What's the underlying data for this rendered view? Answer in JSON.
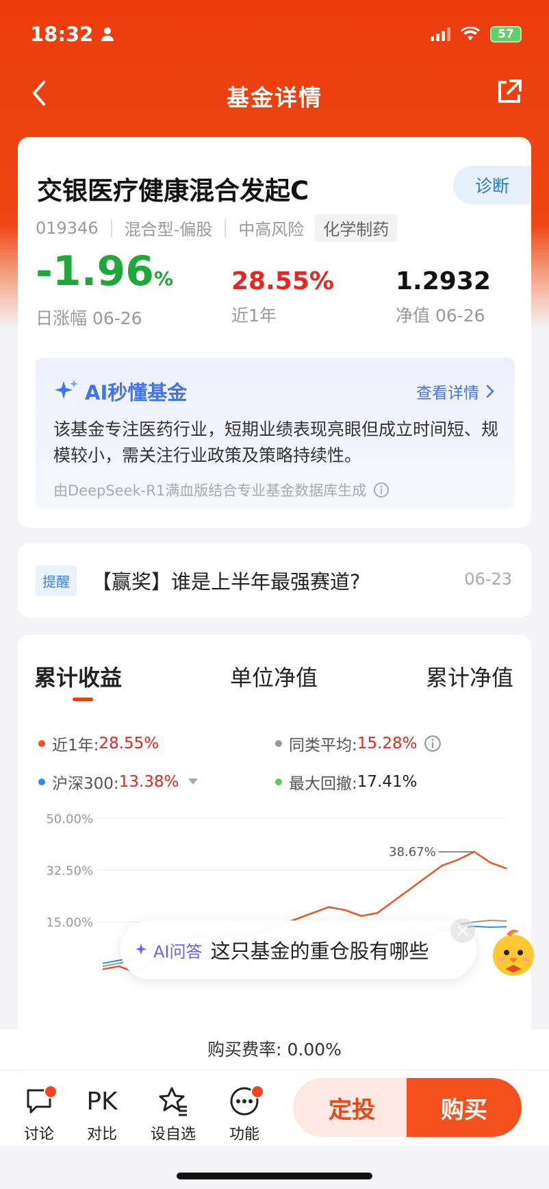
{
  "status": {
    "time": "18:32",
    "battery": "57"
  },
  "nav": {
    "title": "基金详情"
  },
  "fund": {
    "name": "交银医疗健康混合发起C",
    "diagnose_label": "诊断",
    "code": "019346",
    "type": "混合型-偏股",
    "risk": "中高风险",
    "sector": "化学制药",
    "daily_change": "-1.96",
    "daily_change_unit": "%",
    "daily_change_label": "日涨幅 06-26",
    "year_return": "28.55%",
    "year_return_label": "近1年",
    "nav_value": "1.2932",
    "nav_label": "净值 06-26"
  },
  "ai_summary": {
    "title": "AI秒懂基金",
    "detail_link": "查看详情",
    "text": "该基金专注医药行业，短期业绩表现亮眼但成立时间短、规模较小，需关注行业政策及策略持续性。",
    "footer": "由DeepSeek-R1满血版结合专业基金数据库生成"
  },
  "notice": {
    "tag": "提醒",
    "text": "【赢奖】谁是上半年最强赛道?",
    "date": "06-23"
  },
  "chart_tabs": [
    "累计收益",
    "单位净值",
    "累计净值"
  ],
  "legend": {
    "fund_label": "近1年:",
    "fund_value": "28.55%",
    "peer_label": "同类平均:",
    "peer_value": "15.28%",
    "index_label": "沪深300:",
    "index_value": "13.38%",
    "drawdown_label": "最大回撤:",
    "drawdown_value": "17.41%"
  },
  "colors": {
    "fund": "#f4511e",
    "peer": "#999999",
    "index": "#2d8cf0",
    "drawdown": "#5dc860",
    "accent": "#ec3c0d"
  },
  "chart_data": {
    "type": "line",
    "ylim": [
      0,
      50
    ],
    "ytick_labels": [
      "50.00%",
      "32.50%",
      "15.00%"
    ],
    "yticks": [
      50,
      32.5,
      15
    ],
    "peak_annotation": "38.67%",
    "peak_value": 38.67,
    "series": [
      {
        "name": "近1年",
        "values": [
          -1,
          0,
          -2,
          1,
          3,
          2,
          4,
          6,
          8,
          10,
          12,
          14,
          16,
          18,
          20,
          19,
          17,
          18,
          22,
          26,
          30,
          34,
          36,
          38.67,
          35,
          33
        ]
      },
      {
        "name": "同类平均",
        "values": [
          0,
          1,
          2,
          6,
          9,
          10,
          11,
          10,
          12,
          11,
          9,
          10,
          8,
          9,
          7,
          8,
          9,
          10,
          11,
          12,
          11,
          13,
          14,
          15,
          15.5,
          15.28
        ]
      },
      {
        "name": "沪深300",
        "values": [
          1,
          2,
          3,
          6,
          8,
          9,
          10,
          9,
          11,
          10,
          8,
          9,
          7,
          8,
          6,
          7,
          8,
          9,
          10,
          11,
          10,
          12,
          13,
          13.5,
          13.2,
          13.38
        ]
      }
    ]
  },
  "ai_bubble": {
    "label": "AI问答",
    "question": "这只基金的重仓股有哪些"
  },
  "fee": {
    "text": "购买费率: 0.00%"
  },
  "bottom_bar": {
    "items": [
      {
        "label": "讨论"
      },
      {
        "label": "对比",
        "icon_text": "PK"
      },
      {
        "label": "设自选"
      },
      {
        "label": "功能"
      }
    ],
    "sip_label": "定投",
    "buy_label": "购买"
  }
}
